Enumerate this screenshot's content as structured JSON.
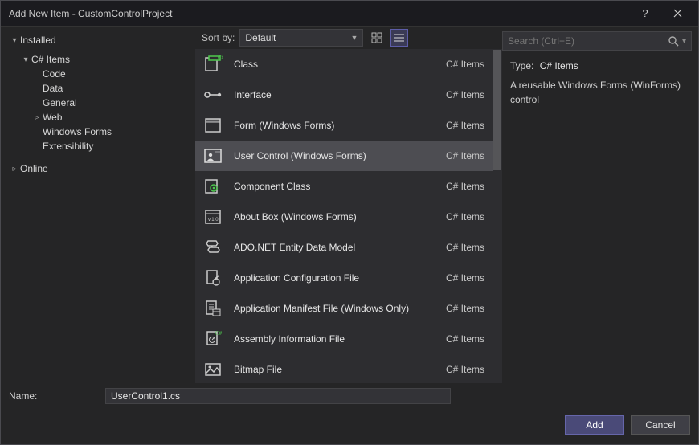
{
  "window": {
    "title": "Add New Item - CustomControlProject"
  },
  "sidebar": {
    "installed": "Installed",
    "csitems": "C# Items",
    "children": [
      "Code",
      "Data",
      "General",
      "Web",
      "Windows Forms",
      "Extensibility"
    ],
    "online": "Online"
  },
  "toolbar": {
    "sortby_label": "Sort by:",
    "sortby_value": "Default"
  },
  "search": {
    "placeholder": "Search (Ctrl+E)"
  },
  "templates": [
    {
      "name": "Class",
      "category": "C# Items",
      "icon": "class",
      "accent": "#4ec94e"
    },
    {
      "name": "Interface",
      "category": "C# Items",
      "icon": "interface",
      "accent": "#cccccc"
    },
    {
      "name": "Form (Windows Forms)",
      "category": "C# Items",
      "icon": "form",
      "accent": "#cccccc"
    },
    {
      "name": "User Control (Windows Forms)",
      "category": "C# Items",
      "icon": "usercontrol",
      "accent": "#cccccc",
      "selected": true
    },
    {
      "name": "Component Class",
      "category": "C# Items",
      "icon": "component",
      "accent": "#4ec94e"
    },
    {
      "name": "About Box (Windows Forms)",
      "category": "C# Items",
      "icon": "aboutbox",
      "accent": "#cccccc"
    },
    {
      "name": "ADO.NET Entity Data Model",
      "category": "C# Items",
      "icon": "ado",
      "accent": "#cccccc"
    },
    {
      "name": "Application Configuration File",
      "category": "C# Items",
      "icon": "config",
      "accent": "#cccccc"
    },
    {
      "name": "Application Manifest File (Windows Only)",
      "category": "C# Items",
      "icon": "manifest",
      "accent": "#cccccc"
    },
    {
      "name": "Assembly Information File",
      "category": "C# Items",
      "icon": "assembly",
      "accent": "#4ec94e"
    },
    {
      "name": "Bitmap File",
      "category": "C# Items",
      "icon": "bitmap",
      "accent": "#cccccc"
    }
  ],
  "info": {
    "type_label": "Type:",
    "type_value": "C# Items",
    "description": "A reusable Windows Forms (WinForms) control"
  },
  "bottom": {
    "name_label": "Name:",
    "name_value": "UserControl1.cs",
    "add_label": "Add",
    "cancel_label": "Cancel"
  }
}
